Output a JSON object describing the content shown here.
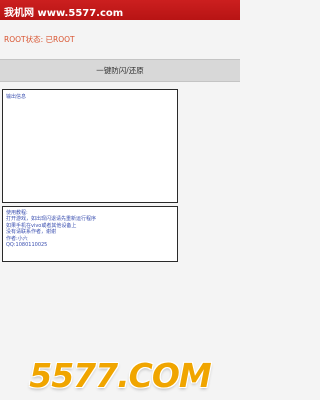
{
  "header": {
    "site_label": "我机网 www.5577.com",
    "background_color": "#c41a1a"
  },
  "status": {
    "root_text": "ROOT状态: 已ROOT",
    "color": "#d9532f"
  },
  "actions": {
    "restore_label": "一键防闪/还原"
  },
  "output": {
    "label": "输出信息"
  },
  "info": {
    "lines": [
      "使用教程:",
      "打开游戏，如出现闪退请先重新运行程序",
      "如果手机在vivo或者其他设备上",
      "没有请联系作者，谢谢",
      "作者:小六",
      "QQ:1080110025"
    ]
  },
  "watermark": {
    "text": "5577.COM",
    "color": "#f0a500"
  }
}
